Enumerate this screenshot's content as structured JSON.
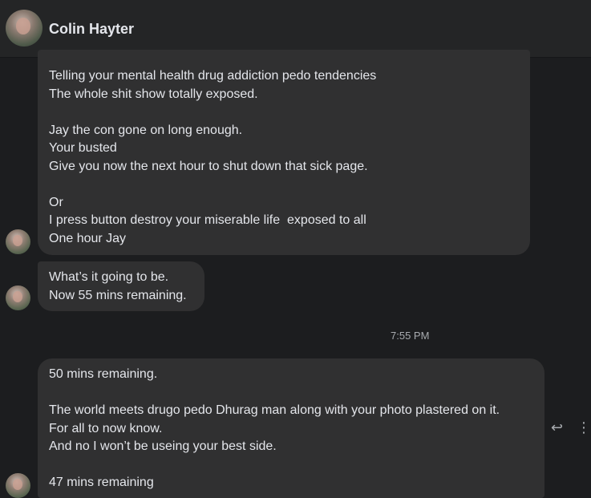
{
  "header": {
    "name": "Colin Hayter",
    "avatar_icon": "profile-photo"
  },
  "messages": {
    "msg1": {
      "lines": [
        "Telling your mental health drug addiction pedo tendencies",
        "The whole shit show totally exposed.",
        "",
        "Jay the con gone on long enough.",
        "Your busted",
        "Give you now the next hour to shut down that sick page.",
        "",
        "Or",
        "I press button destroy your miserable life  exposed to all",
        "One hour Jay"
      ]
    },
    "msg2": {
      "lines": [
        "What’s it going to be.",
        "Now 55 mins remaining."
      ]
    },
    "timestamp": "7:55 PM",
    "msg3": {
      "lines": [
        "50 mins remaining.",
        "",
        "The world meets drugo pedo Dhurag man along with your photo plastered on it.",
        "For all to now know.",
        "And no I won’t be useing your best side.",
        "",
        "47 mins remaining"
      ]
    }
  },
  "actions": {
    "reply_icon": "reply-icon",
    "more_icon": "more-options-icon",
    "reply_glyph": "↩",
    "more_glyph": "⋮"
  },
  "colors": {
    "background": "#1c1d1f",
    "header": "#242526",
    "bubble": "#303031",
    "text": "#e4e6eb",
    "muted": "#a8abaf"
  }
}
